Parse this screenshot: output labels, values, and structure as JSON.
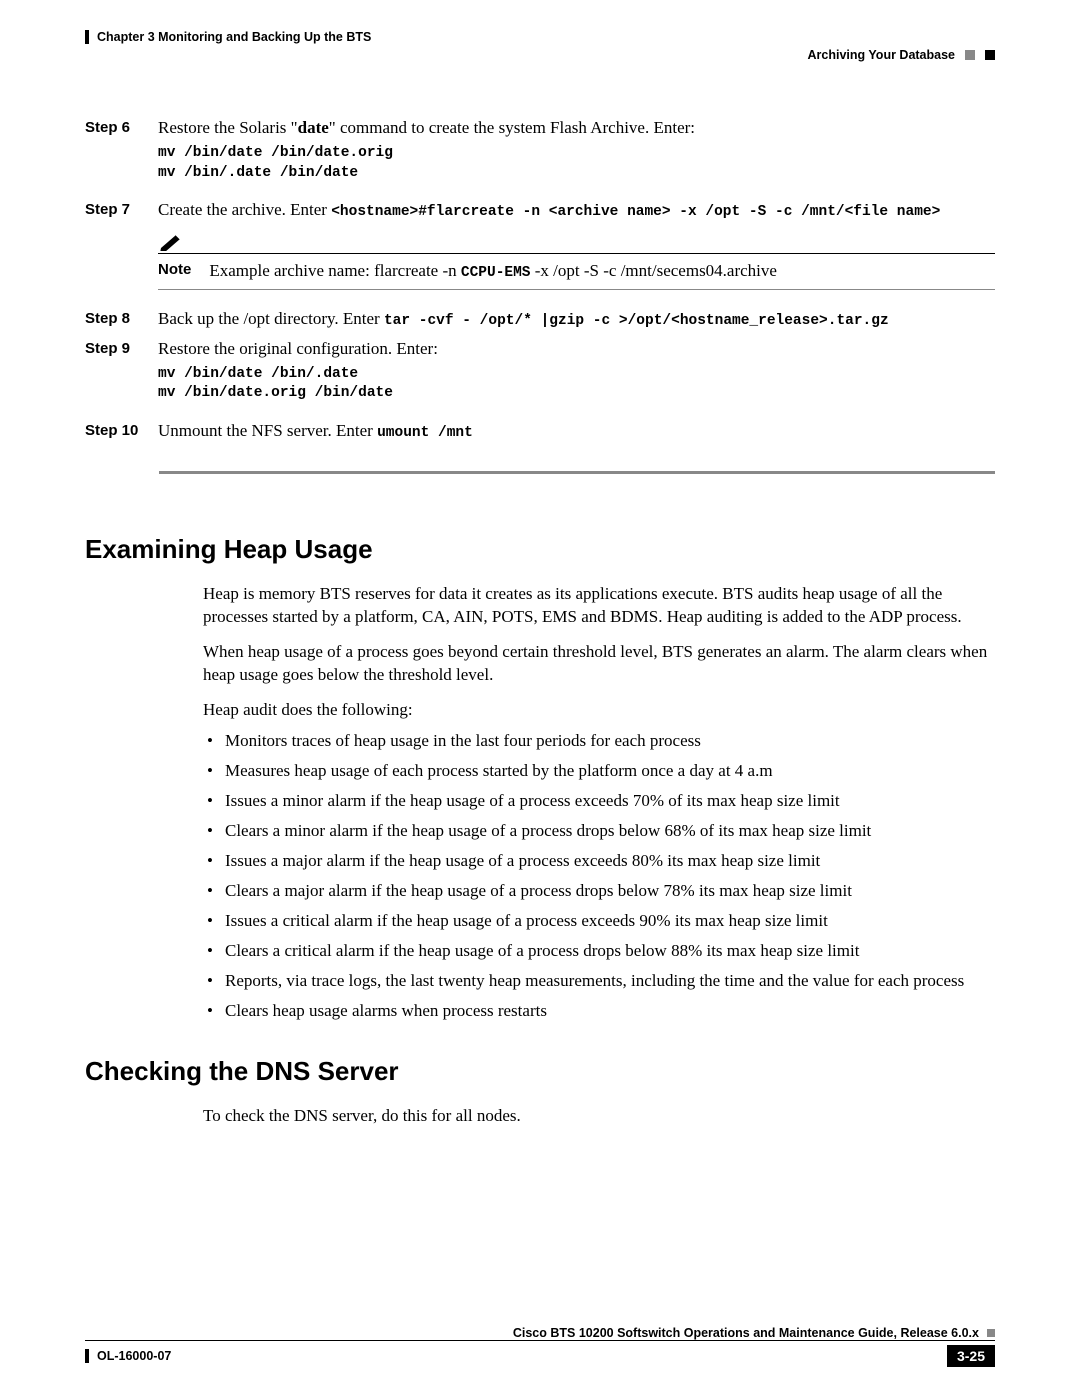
{
  "header": {
    "chapter": "Chapter 3    Monitoring and Backing Up the BTS",
    "section": "Archiving Your Database"
  },
  "steps": {
    "s6": {
      "label": "Step 6",
      "text_a": "Restore the Solaris \"",
      "text_b": "date",
      "text_c": "\" command to create the system Flash Archive. Enter:",
      "code": "mv /bin/date /bin/date.orig\nmv /bin/.date /bin/date"
    },
    "s7": {
      "label": "Step 7",
      "text_a": "Create the archive. Enter ",
      "code_inline": "<hostname>#flarcreate -n <archive name> -x /opt -S -c /mnt/<file name>",
      "note_label": "Note",
      "note_a": "Example archive name: flarcreate -n ",
      "note_b": "CCPU-EMS",
      "note_c": " -x /opt -S -c /mnt/secems04.archive"
    },
    "s8": {
      "label": "Step 8",
      "text_a": "Back up the /opt directory. Enter ",
      "code_inline": "tar -cvf - /opt/* |gzip -c >/opt/<hostname_release>.tar.gz"
    },
    "s9": {
      "label": "Step 9",
      "text": "Restore the original configuration. Enter:",
      "code": "mv /bin/date /bin/.date\nmv /bin/date.orig /bin/date"
    },
    "s10": {
      "label": "Step 10",
      "text_a": "Unmount the NFS server. Enter ",
      "code_inline": "umount /mnt"
    }
  },
  "heap": {
    "title": "Examining Heap Usage",
    "p1": "Heap is memory BTS reserves for data it creates as its applications execute. BTS audits heap usage of all the processes started by a platform, CA, AIN, POTS, EMS and BDMS. Heap auditing is added to the ADP process.",
    "p2": "When heap usage of a process goes beyond certain threshold level, BTS generates an alarm. The alarm clears when heap usage goes below the threshold level.",
    "p3": "Heap audit does the following:",
    "bullets": [
      "Monitors traces of heap usage in the last four periods for each process",
      "Measures heap usage of each process started by the platform once a day at 4 a.m",
      "Issues a minor alarm if the heap usage of a process exceeds 70% of its max heap size limit",
      "Clears a minor alarm if the heap usage of a process drops below 68% of its max heap size limit",
      "Issues a major alarm if the heap usage of a process exceeds 80% its max heap size limit",
      "Clears a major alarm if the heap usage of a process drops below 78% its max heap size limit",
      "Issues a critical alarm if the heap usage of a process exceeds 90% its max heap size limit",
      "Clears a critical alarm if the heap usage of a process drops below 88% its max heap size limit",
      "Reports, via trace logs, the last twenty heap measurements, including the time and the value for each process",
      "Clears heap usage alarms when process restarts"
    ]
  },
  "dns": {
    "title": "Checking the DNS Server",
    "p1": "To check the DNS server, do this for all nodes."
  },
  "footer": {
    "title": "Cisco BTS 10200 Softswitch Operations and Maintenance Guide, Release 6.0.x",
    "docid": "OL-16000-07",
    "page": "3-25"
  }
}
